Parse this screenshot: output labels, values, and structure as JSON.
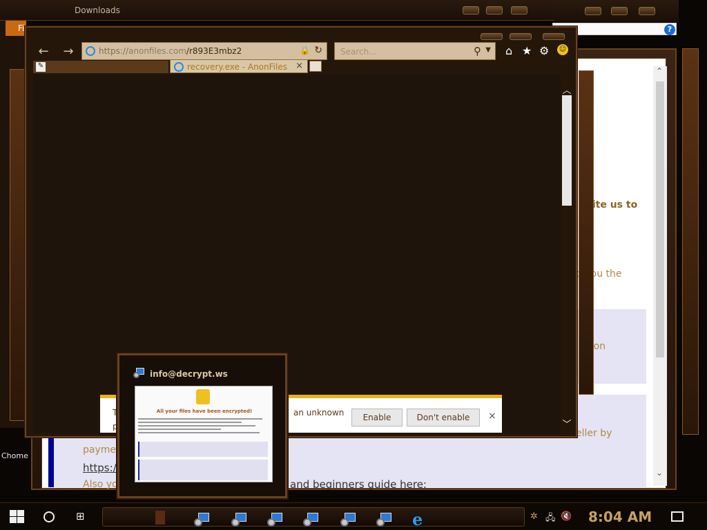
{
  "explorer": {
    "title": "Downloads",
    "ribbon_label": "Fi"
  },
  "browser": {
    "address": {
      "scheme": "https://",
      "host": "anonfiles.com",
      "path": "/r893E3mbz2"
    },
    "search_placeholder": "Search...",
    "tab": {
      "title": "recovery.exe - AnonFiles",
      "close": "×"
    },
    "toolbar_icons": [
      "home-icon",
      "star-icon",
      "gear-icon",
      "smiley-icon"
    ]
  },
  "notification_bar": {
    "message_prefix": "T",
    "message_fragment": "an unknown",
    "message_p": "p",
    "enable_label": "Enable",
    "dont_enable_label": "Don't enable",
    "close": "×"
  },
  "background_page": {
    "text_write_us": "write us to",
    "text_you_the": "d you the",
    "text_non": "/non",
    "text_seller": "eller by",
    "text_payme": "payme",
    "text_https": "https:/",
    "text_also": "Also yo",
    "text_beginners": "and beginners guide here:"
  },
  "thumbnail": {
    "title": "info@decrypt.ws",
    "heading": "All your files have been encrypted!"
  },
  "taskbar": {
    "clock": "8:04 AM",
    "desktop_label": "Chome"
  }
}
